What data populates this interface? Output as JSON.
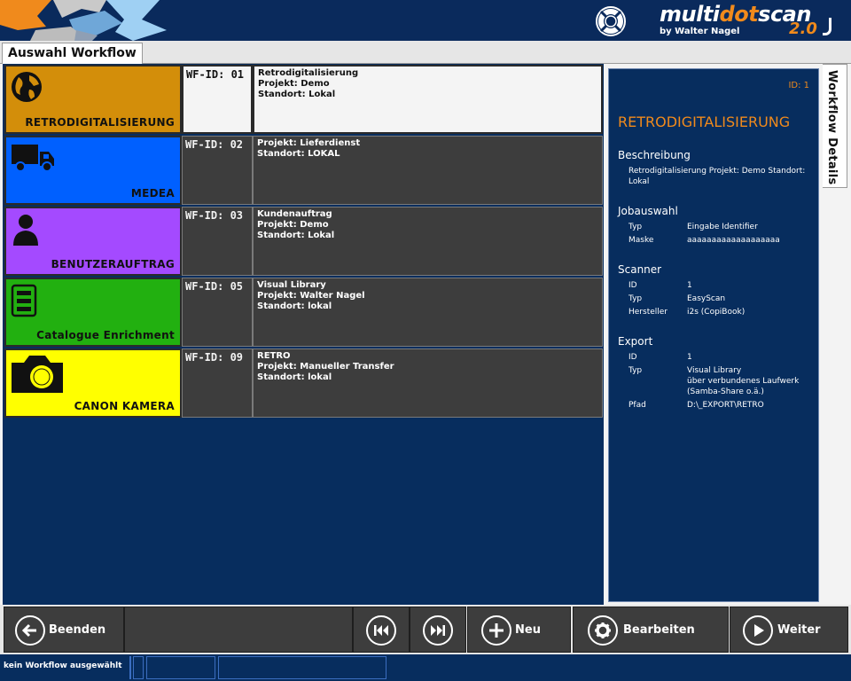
{
  "header": {
    "logo_text_1": "multi",
    "logo_text_2": "dot",
    "logo_text_3": "scan",
    "logo_sub": "by Walter Nagel",
    "logo_version": "2.0"
  },
  "tabs": {
    "active_label": "Auswahl Workflow"
  },
  "workflows": [
    {
      "label": "RETRODIGITALISIERUNG",
      "color": "#d38e0a",
      "icon": "globe-icon",
      "wfid": "WF-ID: 01",
      "line1": "Retrodigitalisierung",
      "line2": "Projekt: Demo",
      "line3": "Standort: Lokal",
      "selected": true
    },
    {
      "label": "MEDEA",
      "color": "#0060ff",
      "icon": "truck-icon",
      "wfid": "WF-ID: 02",
      "line1": "Projekt:  Lieferdienst",
      "line2": "Standort: LOKAL",
      "line3": "",
      "selected": false
    },
    {
      "label": "BENUTZERAUFTRAG",
      "color": "#a44aff",
      "icon": "person-icon",
      "wfid": "WF-ID: 03",
      "line1": "Kundenauftrag",
      "line2": "Projekt:  Demo",
      "line3": "Standort: Lokal",
      "selected": false
    },
    {
      "label": "Catalogue Enrichment",
      "color": "#22b010",
      "icon": "cabinet-icon",
      "wfid": "WF-ID: 05",
      "line1": "Visual Library",
      "line2": "Projekt:  Walter Nagel",
      "line3": "Standort: lokal",
      "selected": false
    },
    {
      "label": "CANON KAMERA",
      "color": "#ffff00",
      "icon": "camera-icon",
      "wfid": "WF-ID: 09",
      "line1": "RETRO",
      "line2": "Projekt: Manueller Transfer",
      "line3": "Standort: lokal",
      "selected": false
    }
  ],
  "detail": {
    "tab_label": "Workflow Details",
    "id_label": "ID: 1",
    "title": "RETRODIGITALISIERUNG",
    "beschreibung_heading": "Beschreibung",
    "beschreibung_text": "Retrodigitalisierung Projekt: Demo Standort: Lokal",
    "jobauswahl_heading": "Jobauswahl",
    "job_typ_key": "Typ",
    "job_typ_val": "Eingabe Identifier",
    "job_maske_key": "Maske",
    "job_maske_val": "aaaaaaaaaaaaaaaaaaa",
    "scanner_heading": "Scanner",
    "sc_id_key": "ID",
    "sc_id_val": "1",
    "sc_typ_key": "Typ",
    "sc_typ_val": "EasyScan",
    "sc_hersteller_key": "Hersteller",
    "sc_hersteller_val": "i2s (CopiBook)",
    "export_heading": "Export",
    "ex_id_key": "ID",
    "ex_id_val": "1",
    "ex_typ_key": "Typ",
    "ex_typ_val_1": "Visual Library",
    "ex_typ_val_2": "über verbundenes Laufwerk",
    "ex_typ_val_3": "(Samba-Share o.ä.)",
    "ex_pfad_key": "Pfad",
    "ex_pfad_val": "D:\\_EXPORT\\RETRO"
  },
  "toolbar": {
    "quit_label": "Beenden",
    "new_label": "Neu",
    "edit_label": "Bearbeiten",
    "next_label": "Weiter"
  },
  "status": {
    "text": "kein Workflow ausgewählt"
  },
  "colors": {
    "navy": "#072d5e",
    "accent": "#f08a1c",
    "panel_gray": "#3d3d3d"
  }
}
